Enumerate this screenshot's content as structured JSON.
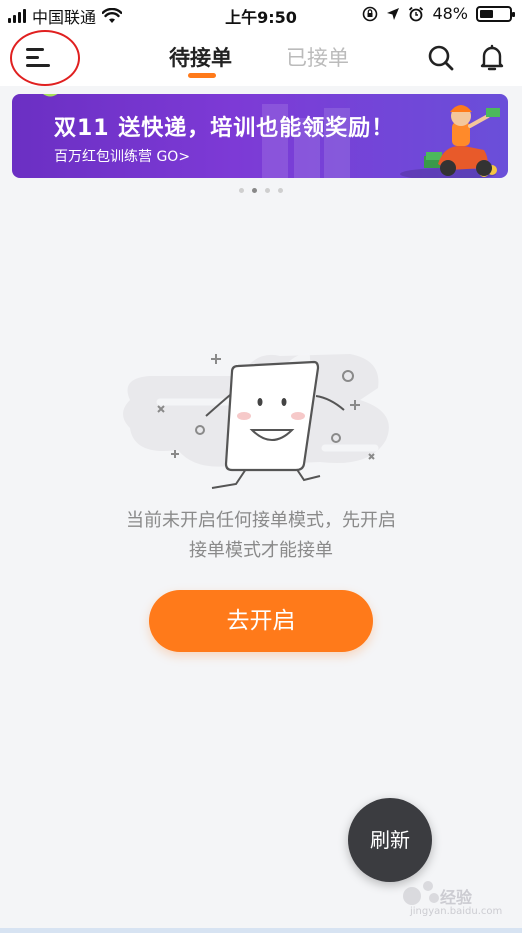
{
  "status_bar": {
    "carrier": "中国联通",
    "time": "上午9:50",
    "battery_percent": "48%",
    "battery_level": 0.48,
    "icons": [
      "signal-icon",
      "wifi-icon",
      "orientation-lock-icon",
      "location-icon",
      "alarm-icon",
      "battery-icon"
    ]
  },
  "header": {
    "tabs": [
      {
        "label": "待接单",
        "active": true
      },
      {
        "label": "已接单",
        "active": false
      }
    ],
    "icons": [
      "menu-icon",
      "search-icon",
      "bell-icon"
    ],
    "accent_color": "#ff7a1a",
    "highlight_circle_color": "#e02020"
  },
  "banner": {
    "title": "双11 送快递，培训也能领奖励！",
    "subtitle": "百万红包训练营 GO>",
    "background_color": "#7d3ad6"
  },
  "carousel": {
    "page_count": 4,
    "active_index": 1
  },
  "empty_state": {
    "message_line1": "当前未开启任何接单模式，先开启",
    "message_line2": "接单模式才能接单",
    "action_label": "去开启"
  },
  "refresh_label": "刷新",
  "watermark": {
    "text": "经验",
    "url": "jingyan.baidu.com"
  }
}
